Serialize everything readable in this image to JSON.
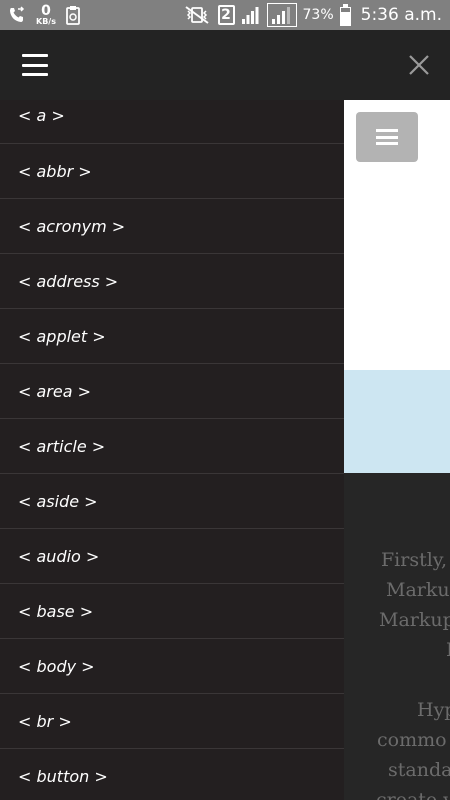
{
  "status_bar": {
    "net_speed_value": "0",
    "net_speed_unit": "KB/s",
    "sim_slot": "2",
    "battery_percent": "73%",
    "battery_level": 0.73,
    "time": "5:36 a.m."
  },
  "drawer": {
    "items": [
      {
        "label": "< a >"
      },
      {
        "label": "< abbr >"
      },
      {
        "label": "< acronym >"
      },
      {
        "label": "< address >"
      },
      {
        "label": "< applet >"
      },
      {
        "label": "< area >"
      },
      {
        "label": "< article >"
      },
      {
        "label": "< aside >"
      },
      {
        "label": "< audio >"
      },
      {
        "label": "< base >"
      },
      {
        "label": "< body >"
      },
      {
        "label": "< br >"
      },
      {
        "label": "< button >"
      }
    ]
  },
  "content": {
    "lines": [
      "Firstly,",
      "Marku",
      "Markup",
      "I",
      "Hyp",
      "commo",
      "standa",
      "create v"
    ]
  }
}
